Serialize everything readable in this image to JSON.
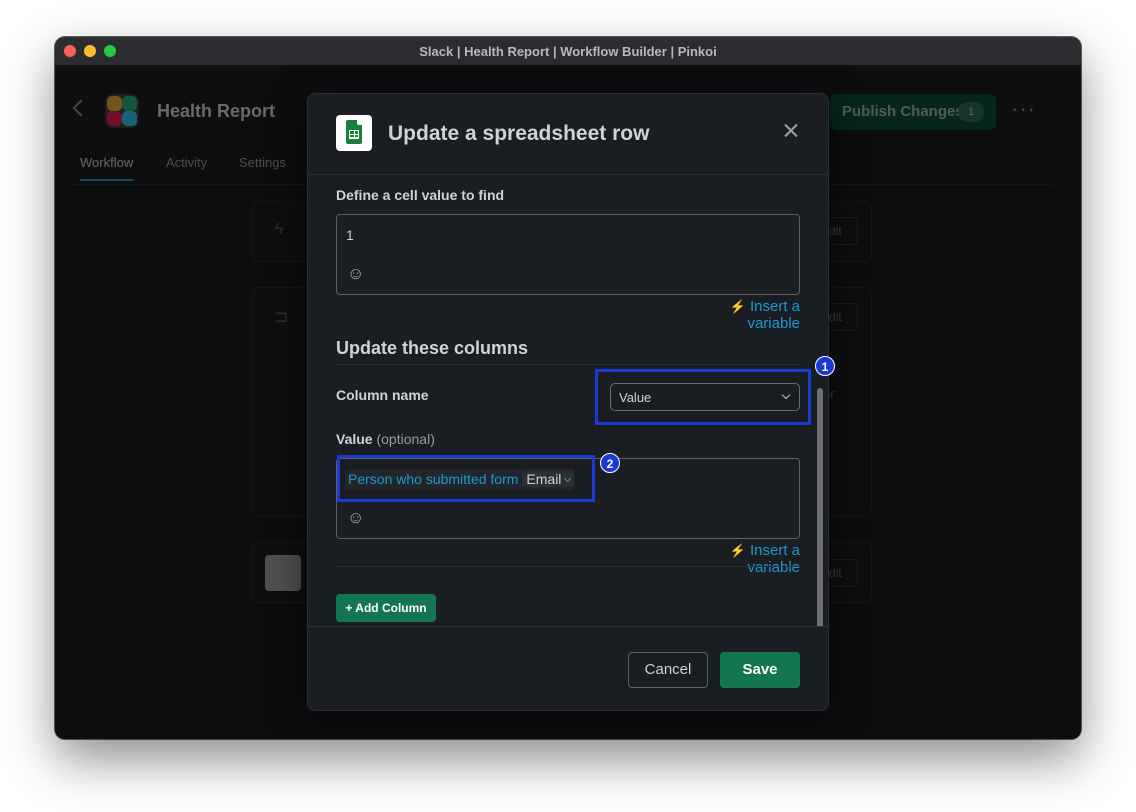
{
  "window": {
    "title": "Slack | Health Report | Workflow Builder | Pinkoi"
  },
  "app": {
    "name": "Health Report",
    "tabs": [
      {
        "label": "Workflow",
        "active": true
      },
      {
        "label": "Activity",
        "active": false
      },
      {
        "label": "Settings",
        "active": false
      }
    ],
    "publish_label": "Publish Changes",
    "publish_count": "1",
    "edit_label": "Edit",
    "step_text_fragment": "or"
  },
  "modal": {
    "title": "Update a spreadsheet row",
    "find_label": "Define a cell value to find",
    "find_value": "1",
    "insert_variable": "Insert a variable",
    "section_title": "Update these columns",
    "column_name_label": "Column name",
    "column_select_value": "Value",
    "value_label": "Value",
    "value_optional": "(optional)",
    "token_source": "Person who submitted form",
    "token_field": "Email",
    "add_column": "+ Add Column",
    "cancel": "Cancel",
    "save": "Save"
  },
  "annotations": [
    {
      "label": "1"
    },
    {
      "label": "2"
    }
  ],
  "colors": {
    "accent": "#1d9bd1",
    "primary_button": "#137651",
    "highlight": "#1a3ad6"
  }
}
